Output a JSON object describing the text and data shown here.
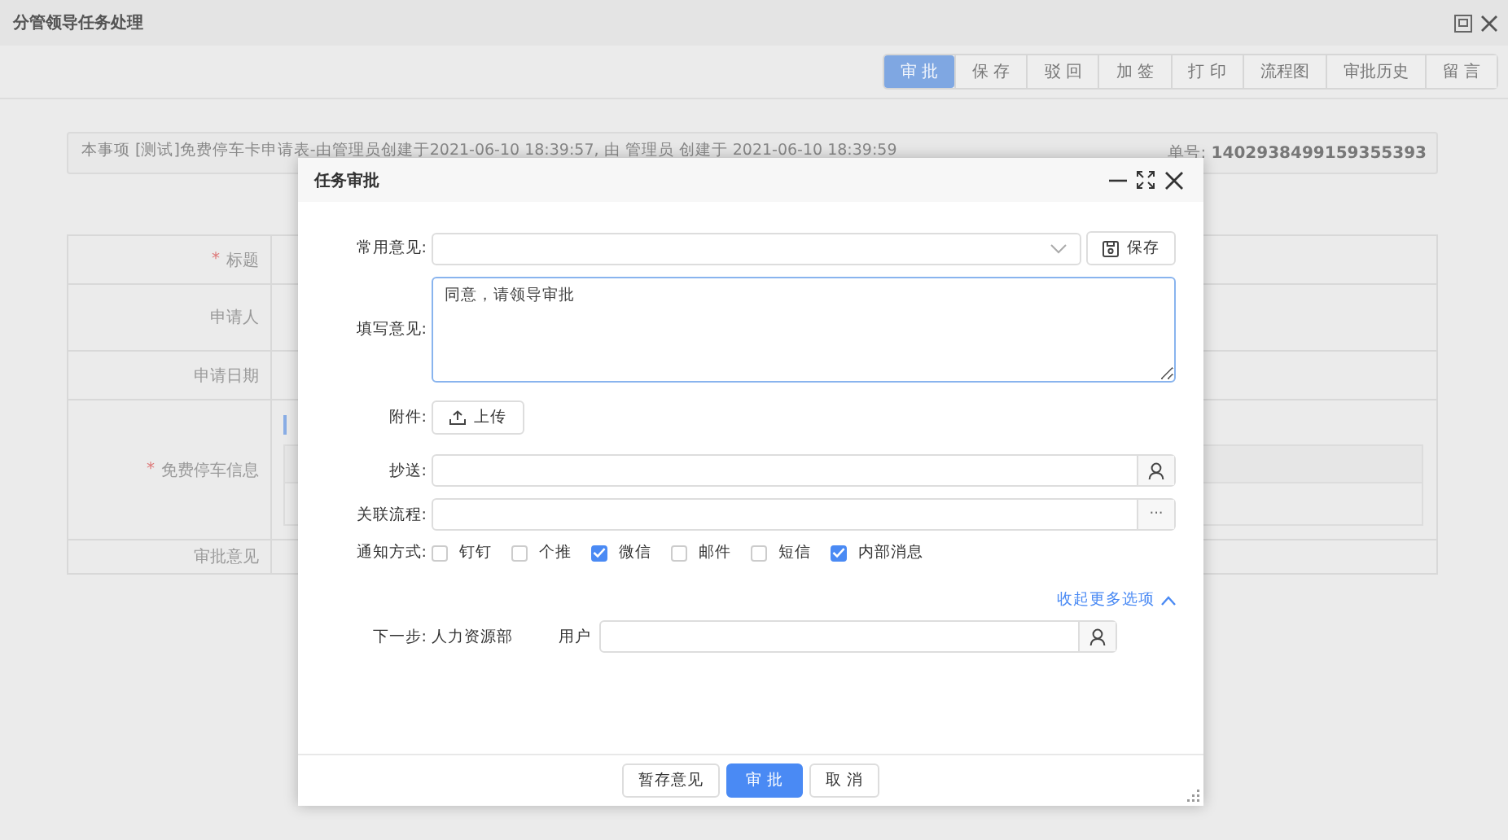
{
  "window": {
    "title": "分管领导任务处理"
  },
  "toolbar": [
    {
      "label": "审 批",
      "selected": true
    },
    {
      "label": "保 存",
      "selected": false
    },
    {
      "label": "驳 回",
      "selected": false
    },
    {
      "label": "加 签",
      "selected": false
    },
    {
      "label": "打 印",
      "selected": false
    },
    {
      "label": "流程图",
      "selected": false
    },
    {
      "label": "审批历史",
      "selected": false
    },
    {
      "label": "留 言",
      "selected": false
    }
  ],
  "info_bar": {
    "text": "本事项 [测试]免费停车卡申请表-由管理员创建于2021-06-10 18:39:57, 由 管理员 创建于 2021-06-10 18:39:59",
    "number_label": "单号:",
    "number": "1402938499159355393"
  },
  "required_mark": "*",
  "form": [
    {
      "label": "标题",
      "required": true,
      "kind": "text"
    },
    {
      "label": "申请人",
      "required": false,
      "kind": "text"
    },
    {
      "label": "申请日期",
      "required": false,
      "kind": "text"
    },
    {
      "label": "免费停车信息",
      "required": true,
      "kind": "subtable"
    },
    {
      "label": "审批意见",
      "required": false,
      "kind": "text"
    }
  ],
  "dialog": {
    "title": "任务审批",
    "common_opinion": {
      "label": "常用意见:",
      "save_button": "保存"
    },
    "opinion": {
      "label": "填写意见:",
      "value": "同意，请领导审批"
    },
    "attachment": {
      "label": "附件:",
      "button": "上传"
    },
    "cc": {
      "label": "抄送:"
    },
    "related_flow": {
      "label": "关联流程:",
      "button": "···"
    },
    "notify": {
      "label": "通知方式:",
      "options": [
        {
          "label": "钉钉",
          "checked": false
        },
        {
          "label": "个推",
          "checked": false
        },
        {
          "label": "微信",
          "checked": true
        },
        {
          "label": "邮件",
          "checked": false
        },
        {
          "label": "短信",
          "checked": false
        },
        {
          "label": "内部消息",
          "checked": true
        }
      ]
    },
    "collapse_link": "收起更多选项",
    "next_step": {
      "label": "下一步:",
      "value": "人力资源部",
      "user_label": "用户"
    },
    "buttons": [
      {
        "label": "暂存意见",
        "primary": false
      },
      {
        "label": "审 批",
        "primary": true
      },
      {
        "label": "取 消",
        "primary": false
      }
    ]
  }
}
